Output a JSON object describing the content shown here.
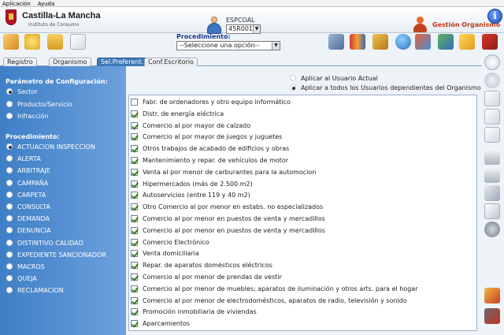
{
  "menubar": {
    "items": [
      "Aplicación",
      "Ayuda"
    ]
  },
  "header": {
    "brand_name": "Castilla-La Mancha",
    "brand_subtitle": "Instituto de Consumo",
    "org_code_label": "ESPCOAL",
    "org_code_value": "45R001",
    "gestion_label": "Gestión Organismo",
    "info_label": "i"
  },
  "procedure": {
    "label": "Procedimiento:",
    "selected": "--Seleccione una opción--"
  },
  "tabs": [
    {
      "label": "Registro",
      "active": false
    },
    {
      "label": "Organismo",
      "active": false
    },
    {
      "label": "Sel.Preferent.",
      "active": true
    },
    {
      "label": "Conf.Escritorio",
      "active": false
    }
  ],
  "config": {
    "title": "Parámetro de Configuración:",
    "options": [
      {
        "label": "Sector",
        "selected": true
      },
      {
        "label": "Producto/Servicio",
        "selected": false
      },
      {
        "label": "Infracción",
        "selected": false
      }
    ]
  },
  "procedimiento": {
    "title": "Procedimiento:",
    "options": [
      {
        "label": "ACTUACION INSPECCION",
        "selected": true
      },
      {
        "label": "ALERTA",
        "selected": false
      },
      {
        "label": "ARBITRAJE",
        "selected": false
      },
      {
        "label": "CAMPAÑA",
        "selected": false
      },
      {
        "label": "CARPETA",
        "selected": false
      },
      {
        "label": "CONSULTA",
        "selected": false
      },
      {
        "label": "DEMANDA",
        "selected": false
      },
      {
        "label": "DENUNCIA",
        "selected": false
      },
      {
        "label": "DISTINTIVO CALIDAD",
        "selected": false
      },
      {
        "label": "EXPEDIENTE SANCIONADOR",
        "selected": false
      },
      {
        "label": "MACROS",
        "selected": false
      },
      {
        "label": "QUEJA",
        "selected": false
      },
      {
        "label": "RECLAMACION",
        "selected": false
      }
    ]
  },
  "apply": {
    "options": [
      {
        "label": "Aplicar al Usuario Actual",
        "selected": false
      },
      {
        "label": "Aplicar a todos los Usuarios dependientes del Organismo Actual",
        "selected": true
      }
    ]
  },
  "sectors": [
    {
      "label": "Fabr. de ordenadores y otro equipo informático",
      "checked": false
    },
    {
      "label": "Distr. de energía eléctrica",
      "checked": true
    },
    {
      "label": "Comercio al por mayor de calzado",
      "checked": true
    },
    {
      "label": "Comercio al por mayor de juegos y juguetes",
      "checked": true
    },
    {
      "label": "Otros trabajos de acabado de edificios y obras",
      "checked": true
    },
    {
      "label": "Mantenimiento y repar. de vehículos de motor",
      "checked": true
    },
    {
      "label": "Venta al por menor de carburantes para la automocion",
      "checked": true
    },
    {
      "label": "Hipermercados (más de 2.500 m2)",
      "checked": true
    },
    {
      "label": "Autoservicios (entre 119 y 40 m2)",
      "checked": true
    },
    {
      "label": "Otro Comercio al por menor en estabs. no especializados",
      "checked": true
    },
    {
      "label": "Comercio al por menor en puestos de venta y mercadillos",
      "checked": true
    },
    {
      "label": "Comercio al por menor en puestos de venta y mercadillos",
      "checked": true
    },
    {
      "label": "Comercio Electrónico",
      "checked": true
    },
    {
      "label": "Venta domiciliaria",
      "checked": true
    },
    {
      "label": "Repar. de aparatos domésticos eléctricos",
      "checked": true
    },
    {
      "label": "Comercio al por menor de prendas de vestir",
      "checked": true
    },
    {
      "label": "Comercio al por menor de muebles; aparatos de iluminación y otros arts. para el hogar",
      "checked": true
    },
    {
      "label": "Comercio al por menor de electrodomésticos, aparatos de radio, televisión y sonido",
      "checked": true
    },
    {
      "label": "Promoción inmobiliaria de viviendas",
      "checked": true
    },
    {
      "label": "Aparcamientos",
      "checked": true
    }
  ],
  "colors": {
    "accent": "#3f78b8",
    "panel": "#4f8ed2",
    "brand": "#c03a1a"
  }
}
